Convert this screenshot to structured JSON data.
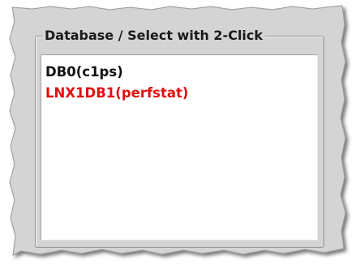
{
  "group": {
    "title": "Database / Select with 2-Click"
  },
  "databases": [
    {
      "label": "DB0(c1ps)",
      "color": "#111111"
    },
    {
      "label": "LNX1DB1(perfstat)",
      "color": "#e01010"
    }
  ],
  "colors": {
    "panel_background": "#d4d4d4",
    "list_background": "#ffffff",
    "highlight_text": "#e01010"
  }
}
